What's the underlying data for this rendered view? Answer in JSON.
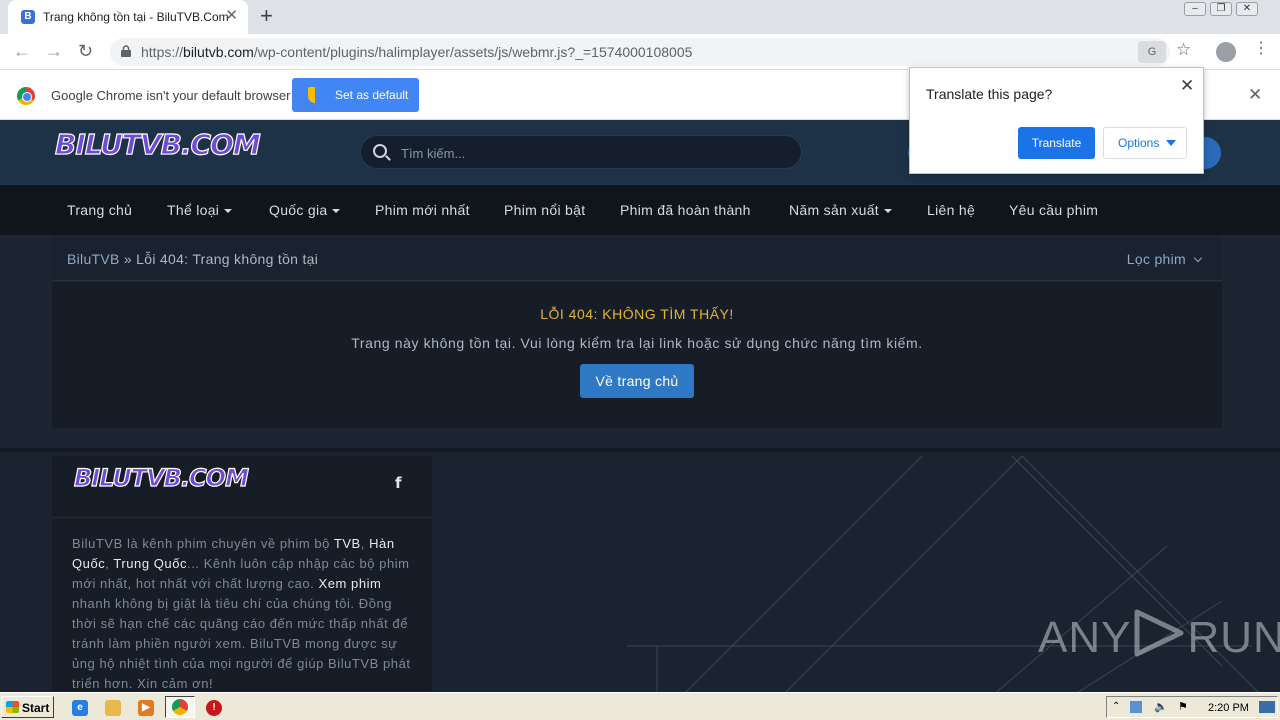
{
  "browser": {
    "tab_title": "Trang không tồn tại - BiluTVB.Com",
    "tab_favicon": "B",
    "url_prefix": "https://",
    "url_domain": "bilutvb.com",
    "url_path": "/wp-content/plugins/halimplayer/assets/js/webmr.js?_=1574000108005",
    "infobar_message": "Google Chrome isn't your default browser",
    "set_default_label": "Set as default",
    "translate_badge": "G"
  },
  "translate_popup": {
    "title": "Translate this page?",
    "translate_label": "Translate",
    "options_label": "Options"
  },
  "site": {
    "logo_text": "BILUTVB.COM",
    "search_placeholder": "Tìm kiếm...",
    "nav": [
      {
        "label": "Trang chủ",
        "dropdown": false
      },
      {
        "label": "Thể loại",
        "dropdown": true
      },
      {
        "label": "Quốc gia",
        "dropdown": true
      },
      {
        "label": "Phim mới nhất",
        "dropdown": false
      },
      {
        "label": "Phim nổi bật",
        "dropdown": false
      },
      {
        "label": "Phim đã hoàn thành",
        "dropdown": false
      },
      {
        "label": "Năm sản xuất",
        "dropdown": true
      },
      {
        "label": "Liên hệ",
        "dropdown": false
      },
      {
        "label": "Yêu cầu phim",
        "dropdown": false
      }
    ],
    "breadcrumb_home": "BiluTVB",
    "breadcrumb_sep": " » ",
    "breadcrumb_current": "Lỗi 404: Trang không tồn tại",
    "filter_label": "Lọc phim",
    "error_title": "LỖI 404: KHÔNG TÌM THẤY!",
    "error_message": "Trang này không tồn tại. Vui lòng kiểm tra lại link hoặc sử dụng chức năng tìm kiếm.",
    "home_button": "Về trang chủ",
    "footer_logo_text": "BILUTVB.COM",
    "facebook_glyph": "f",
    "footer_text": {
      "p1": "BiluTVB là kênh phim chuyên về phim bộ ",
      "l1": "TVB",
      "p2": ", ",
      "l2": "Hàn Quốc",
      "p3": ", ",
      "l3": "Trung Quốc",
      "p4": "... Kênh luôn cập nhập các bộ phim mới nhất, hot nhất với chất lượng cao. ",
      "l4": "Xem phim",
      "p5": " nhanh không bị giật là tiêu chí của chúng tôi. Đồng thời sẽ hạn chế các quãng cáo đến mức thấp nhất để tránh làm phiền người xem. BiluTVB mong được sự ủng hộ nhiệt tình của mọi người để giúp BiluTVB phát triển hơn. Xin cảm ơn!"
    }
  },
  "watermark": {
    "left": "ANY",
    "right": "RUN"
  },
  "taskbar": {
    "start_label": "Start",
    "clock": "2:20 PM"
  },
  "colors": {
    "accent_blue": "#2f78c4",
    "error_yellow": "#e3b434",
    "header_bg": "#1e3247",
    "nav_bg": "#10151c"
  }
}
